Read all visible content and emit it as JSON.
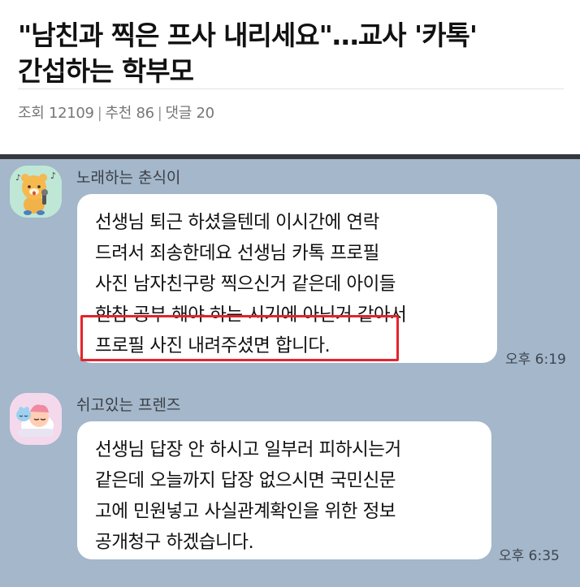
{
  "article": {
    "headline_line1": "\"남친과 찍은 프사 내리세요\"…교사 '카톡'",
    "headline_line2": "간섭하는 학부모",
    "views_label": "조회",
    "views": "12109",
    "recommend_label": "추천",
    "recommend": "86",
    "comments_label": "댓글",
    "comments": "20"
  },
  "chat": {
    "background_color": "#a4b7cb",
    "highlight_color": "#e3242b",
    "messages": [
      {
        "sender": "노래하는 춘식이",
        "avatar_icon": "choonsik-singing-avatar-icon",
        "lines": [
          "선생님 퇴근 하셨을텐데 이시간에 연락",
          "드려서 죄송한데요 선생님 카톡 프로필",
          "사진 남자친구랑 찍으신거 같은데 아이들",
          "한참 공부 해야 하는 시기에 아닌거 같아서",
          "프로필 사진 내려주셨면 합니다."
        ],
        "time": "오후 6:19"
      },
      {
        "sender": "쉬고있는 프렌즈",
        "avatar_icon": "sleeping-friends-avatar-icon",
        "lines": [
          "선생님 답장 안 하시고 일부러 피하시는거",
          "같은데 오늘까지 답장 없으시면 국민신문",
          "고에 민원넣고 사실관계확인을 위한 정보",
          "공개청구 하겠습니다."
        ],
        "time": "오후 6:35"
      }
    ]
  }
}
